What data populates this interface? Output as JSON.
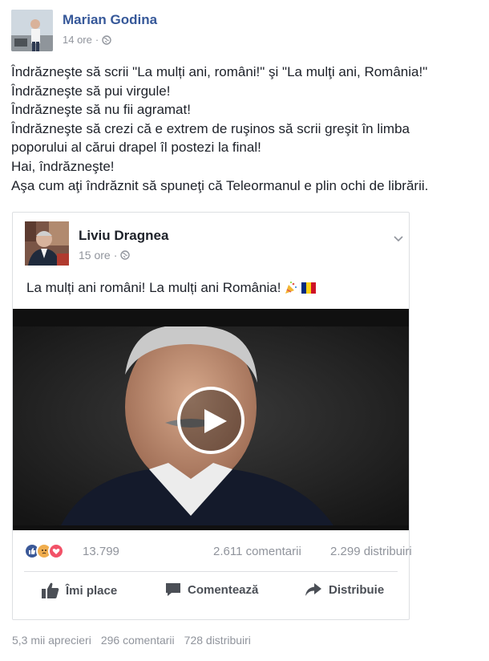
{
  "post": {
    "author": "Marian Godina",
    "time": "14 ore",
    "lines": [
      "Îndrăzneşte să scrii \"La mulți ani, români!\" şi \"La mulţi ani, România!\"",
      "Îndrăzneşte să pui virgule!",
      "Îndrăzneşte să nu fii agramat!",
      "Îndrăzneşte să crezi că e extrem de ruşinos să scrii greşit în limba",
      "poporului al cărui drapel îl postezi la final!",
      "Hai, îndrăzneşte!",
      "Aşa cum aţi îndrăznit să spuneţi că Teleormanul e plin ochi de librării."
    ],
    "footer": {
      "likes": "5,3 mii aprecieri",
      "comments": "296 comentarii",
      "shares": "728 distribuiri"
    }
  },
  "shared": {
    "author": "Liviu Dragnea",
    "time": "15 ore",
    "text": "La mulți ani români! La mulți ani România!",
    "reaction_count": "13.799",
    "comments": "2.611 comentarii",
    "shares": "2.299 distribuiri",
    "actions": {
      "like": "Îmi place",
      "comment": "Comentează",
      "share": "Distribuie"
    }
  },
  "colors": {
    "link_blue": "#365899",
    "like_blue": "#3b5998",
    "angry": "#f0ad4e",
    "love": "#f25268",
    "flag_blue": "#002b7f",
    "flag_yellow": "#fcd116",
    "flag_red": "#ce1126"
  },
  "icons": {
    "privacy": "globe-icon",
    "options": "chevron-down-icon",
    "play": "play-icon",
    "like": "thumbs-up-icon",
    "comment": "speech-bubble-icon",
    "share": "share-arrow-icon",
    "celebrate": "party-popper-icon"
  }
}
